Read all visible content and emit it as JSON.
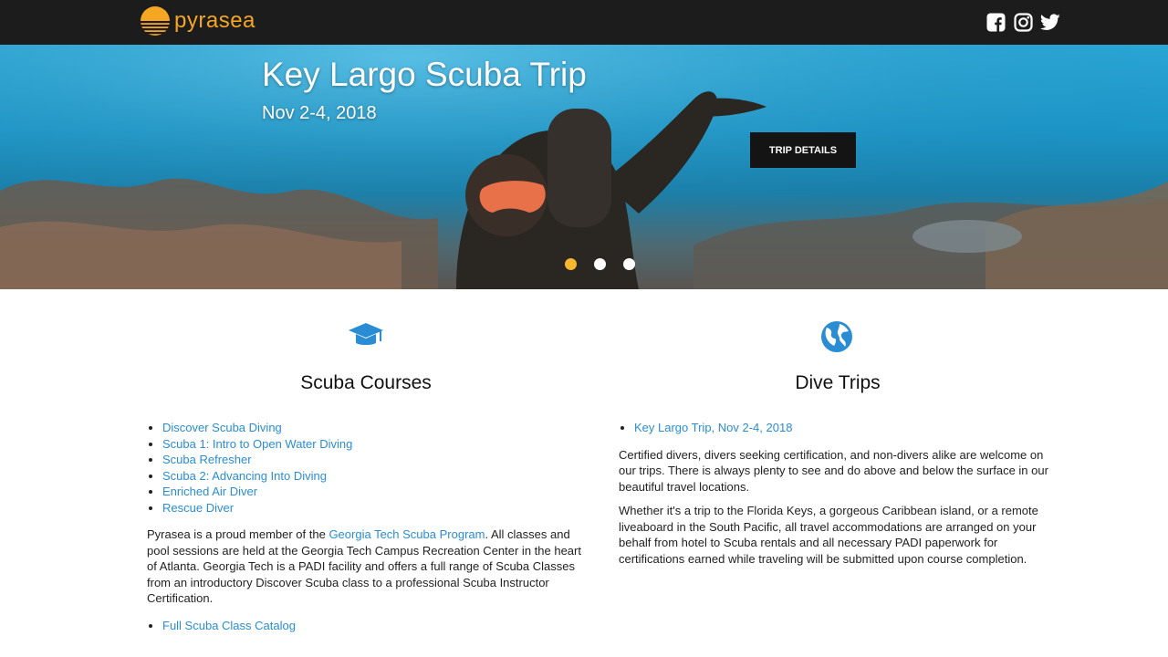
{
  "header": {
    "logo_text": "pyrasea",
    "social": [
      "facebook-icon",
      "instagram-icon",
      "twitter-icon"
    ]
  },
  "hero": {
    "title": "Key Largo Scuba Trip",
    "date": "Nov 2-4, 2018",
    "button_label": "Trip Details",
    "slides": 3,
    "active_slide": 1
  },
  "courses": {
    "icon": "graduation-cap-icon",
    "title": "Scuba Courses",
    "links": [
      "Discover Scuba Diving",
      "Scuba 1: Intro to Open Water Diving",
      "Scuba Refresher",
      "Scuba 2: Advancing Into Diving",
      "Enriched Air Diver",
      "Rescue Diver"
    ],
    "para_before_link": "Pyrasea is a proud member of the ",
    "para_link": "Georgia Tech Scuba Program",
    "para_after_link": ". All classes and pool sessions are held at the Georgia Tech Campus Recreation Center in the heart of Atlanta. Georgia Tech is a PADI facility and offers a full range of Scuba Classes from an introductory Discover Scuba class to a professional Scuba Instructor Certification.",
    "catalog_link": "Full Scuba Class Catalog"
  },
  "trips": {
    "icon": "globe-icon",
    "title": "Dive Trips",
    "links": [
      "Key Largo Trip, Nov 2-4, 2018"
    ],
    "para1": "Certified divers, divers seeking certification, and non-divers alike are welcome on our trips. There is always plenty to see and do above and below the surface in our beautiful travel locations.",
    "para2": "Whether it's a trip to the Florida Keys, a gorgeous Caribbean island, or a remote liveaboard in the South Pacific, all travel accommodations are arranged on your behalf from hotel to Scuba rentals and all necessary PADI paperwork for certifications earned while traveling will be submitted upon course completion."
  },
  "colors": {
    "topbar": "#1c1c1c",
    "accent": "#f5a623",
    "link": "#2a8dd4",
    "icon_blue": "#2a8dd4",
    "active_dot": "#f5b82e"
  }
}
